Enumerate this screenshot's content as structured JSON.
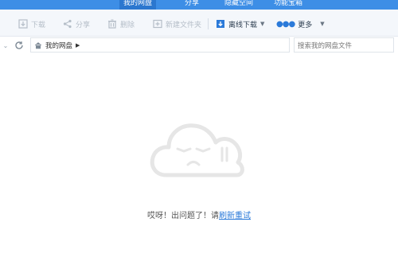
{
  "topnav": {
    "tabs": [
      {
        "label": "我的网盘",
        "active": true
      },
      {
        "label": "分享",
        "active": false
      },
      {
        "label": "隐藏空间",
        "active": false
      },
      {
        "label": "功能宝箱",
        "active": false
      }
    ]
  },
  "toolbar": {
    "download": "下载",
    "share": "分享",
    "delete": "删除",
    "new_folder": "新建文件夹",
    "offline_download": "离线下载",
    "more": "更多"
  },
  "address": {
    "path_root": "我的网盘",
    "search_placeholder": "搜索我的网盘文件"
  },
  "empty_state": {
    "message": "哎呀！出问题了！请",
    "retry_link": "刷新重试"
  },
  "colors": {
    "nav_blue": "#3d8ee6",
    "nav_active": "#2b77cf",
    "link": "#2b7ad9"
  }
}
